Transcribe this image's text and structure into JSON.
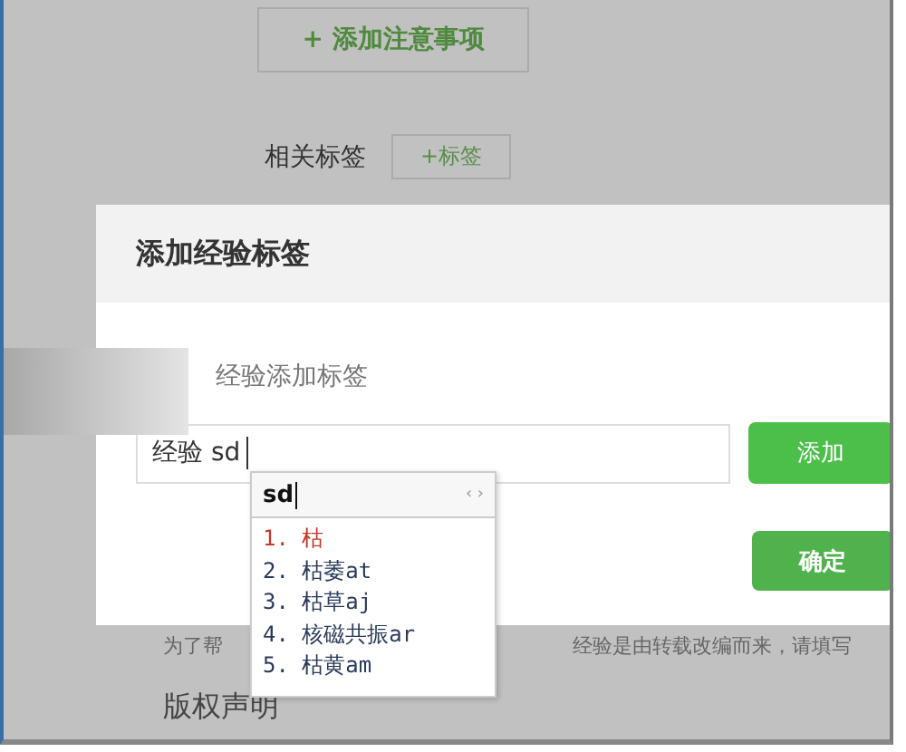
{
  "page": {
    "add_note_button": "+ 添加注意事项",
    "tags_label": "相关标签",
    "add_tag_button": "+标签",
    "notice_left": "为了帮",
    "notice_right": "经验是由转载改编而来，请填写",
    "copyright_heading": "版权声明"
  },
  "dialog": {
    "title": "添加经验标签",
    "hint": "经验添加标签",
    "input_value": "经验 sd",
    "add_button": "添加",
    "confirm_button": "确定"
  },
  "ime": {
    "composition": "sd",
    "arrows": "‹ ›",
    "candidates": [
      {
        "text": "1. 枯",
        "selected": true
      },
      {
        "text": "2. 枯萎at",
        "selected": false
      },
      {
        "text": "3. 枯草aj",
        "selected": false
      },
      {
        "text": "4. 核磁共振ar",
        "selected": false
      },
      {
        "text": "5. 枯黄am",
        "selected": false
      }
    ]
  }
}
